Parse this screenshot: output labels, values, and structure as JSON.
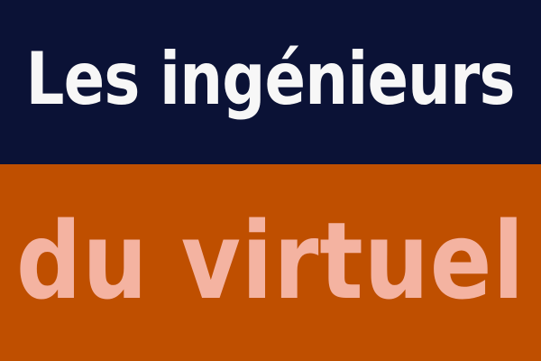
{
  "banner": {
    "line1": "Les ingénieurs",
    "line2": "du virtuel",
    "colors": {
      "top_background": "#0b1236",
      "top_text": "#f7f7f7",
      "bottom_background": "#bf4f00",
      "bottom_text": "#f4b3a1"
    }
  }
}
